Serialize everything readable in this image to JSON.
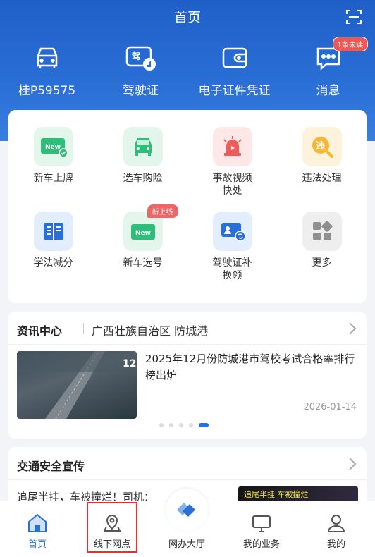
{
  "header": {
    "title": "首页",
    "shortcuts": [
      {
        "label": "桂P59575",
        "icon": "car-icon"
      },
      {
        "label": "驾驶证",
        "icon": "license-icon"
      },
      {
        "label": "电子证件凭证",
        "icon": "wallet-icon"
      },
      {
        "label": "消息",
        "icon": "message-icon",
        "badge": "1条未读"
      }
    ]
  },
  "services": [
    {
      "label": "新车上牌",
      "icon": "new-plate-icon"
    },
    {
      "label": "选车购险",
      "icon": "car-insurance-icon"
    },
    {
      "label": "事故视频\n快处",
      "icon": "alarm-icon"
    },
    {
      "label": "违法处理",
      "icon": "violation-icon"
    },
    {
      "label": "学法减分",
      "icon": "book-icon"
    },
    {
      "label": "新车选号",
      "icon": "plate-select-icon",
      "tag": "新上线"
    },
    {
      "label": "驾驶证补\n换领",
      "icon": "id-card-icon"
    },
    {
      "label": "更多",
      "icon": "more-grid-icon"
    }
  ],
  "news": {
    "section_title": "资讯中心",
    "region": "广西壮族自治区 防城港",
    "item_title": "2025年12月份防城港市驾校考试合格率排行榜出炉",
    "item_date": "2026-01-14",
    "image_text": "12"
  },
  "safety": {
    "section_title": "交通安全宣传",
    "item_text": "追尾半挂，车被撞烂！司机：",
    "image_text": "追尾半挂 车被撞烂"
  },
  "tabs": [
    {
      "label": "首页"
    },
    {
      "label": "线下网点"
    },
    {
      "label": "网办大厅"
    },
    {
      "label": "我的业务"
    },
    {
      "label": "我的"
    }
  ],
  "colors": {
    "brand": "#2a6fd6",
    "highlight": "#e53030"
  }
}
